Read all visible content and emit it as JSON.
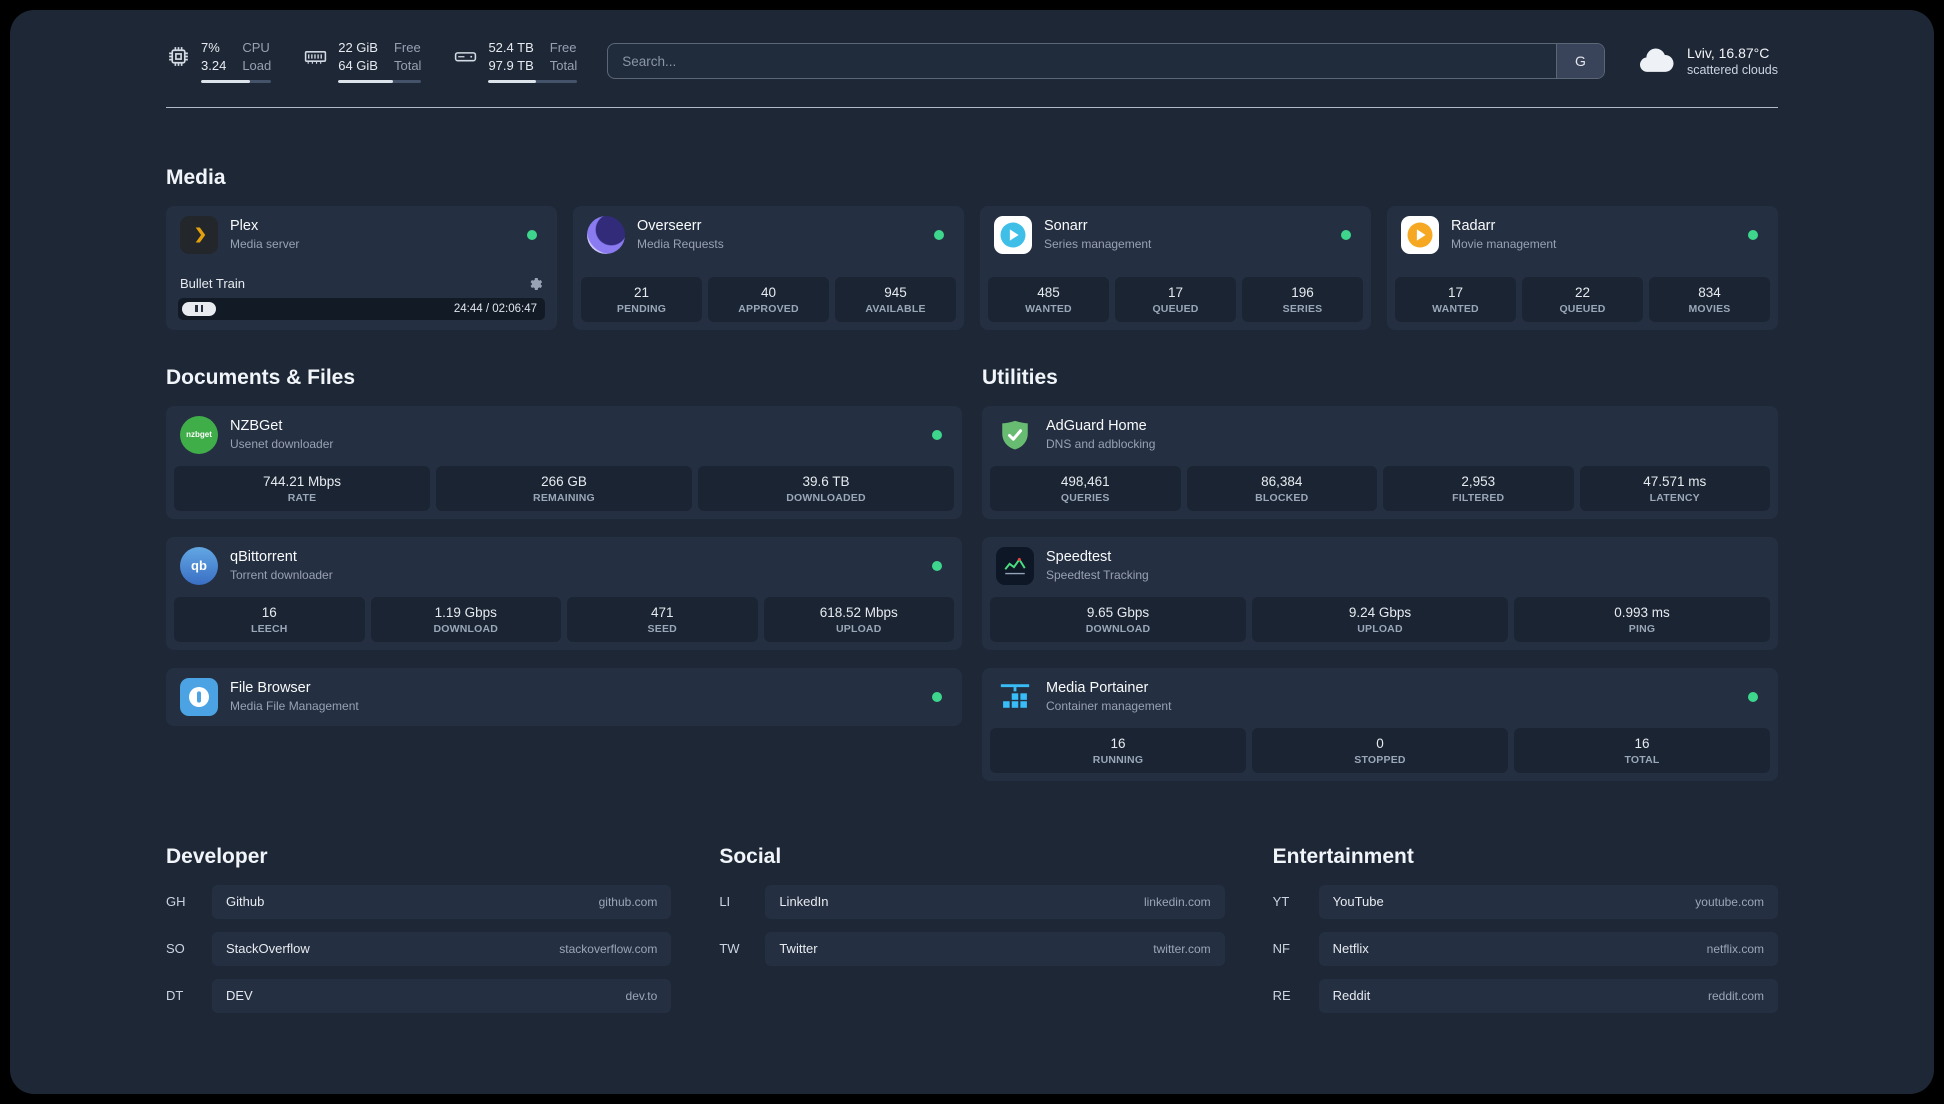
{
  "colors": {
    "status_online": "#3dd68c",
    "plex": "#e5a00d",
    "overseerr": "#8a7bf0",
    "sonarr": "#3fbfe8",
    "radarr": "#f7a823",
    "nzbget": "#3fae49",
    "qbittorrent": "#4e8fd5",
    "filebrowser": "#4ba3e3",
    "adguard": "#68bc71",
    "speedtest_line": "#4ade80",
    "portainer": "#38bdf8"
  },
  "topbar": {
    "resources": [
      {
        "name": "cpu",
        "value_top": "7%",
        "label_top": "CPU",
        "value_bottom": "3.24",
        "label_bottom": "Load",
        "bar_style": "width:70%"
      },
      {
        "name": "memory",
        "value_top": "22 GiB",
        "label_top": "Free",
        "value_bottom": "64 GiB",
        "label_bottom": "Total",
        "bar_style": "width:66%"
      },
      {
        "name": "disk",
        "value_top": "52.4 TB",
        "label_top": "Free",
        "value_bottom": "97.9 TB",
        "label_bottom": "Total",
        "bar_style": "width:54%"
      }
    ],
    "search": {
      "placeholder": "Search...",
      "provider": "G"
    },
    "weather": {
      "location": "Lviv, 16.87°C",
      "condition": "scattered clouds"
    }
  },
  "media": {
    "title": "Media",
    "cards": [
      {
        "title": "Plex",
        "subtitle": "Media server",
        "player": {
          "track": "Bullet Train",
          "time": "24:44 / 02:06:47"
        }
      },
      {
        "title": "Overseerr",
        "subtitle": "Media Requests",
        "stats": [
          {
            "value": "21",
            "label": "PENDING"
          },
          {
            "value": "40",
            "label": "APPROVED"
          },
          {
            "value": "945",
            "label": "AVAILABLE"
          }
        ]
      },
      {
        "title": "Sonarr",
        "subtitle": "Series management",
        "stats": [
          {
            "value": "485",
            "label": "WANTED"
          },
          {
            "value": "17",
            "label": "QUEUED"
          },
          {
            "value": "196",
            "label": "SERIES"
          }
        ]
      },
      {
        "title": "Radarr",
        "subtitle": "Movie management",
        "stats": [
          {
            "value": "17",
            "label": "WANTED"
          },
          {
            "value": "22",
            "label": "QUEUED"
          },
          {
            "value": "834",
            "label": "MOVIES"
          }
        ]
      }
    ]
  },
  "documents": {
    "title": "Documents & Files",
    "cards": [
      {
        "title": "NZBGet",
        "subtitle": "Usenet downloader",
        "icon_text": "nzbget",
        "stats": [
          {
            "value": "744.21 Mbps",
            "label": "RATE"
          },
          {
            "value": "266 GB",
            "label": "REMAINING"
          },
          {
            "value": "39.6 TB",
            "label": "DOWNLOADED"
          }
        ]
      },
      {
        "title": "qBittorrent",
        "subtitle": "Torrent downloader",
        "icon_text": "qb",
        "stats": [
          {
            "value": "16",
            "label": "LEECH"
          },
          {
            "value": "1.19 Gbps",
            "label": "DOWNLOAD"
          },
          {
            "value": "471",
            "label": "SEED"
          },
          {
            "value": "618.52 Mbps",
            "label": "UPLOAD"
          }
        ]
      },
      {
        "title": "File Browser",
        "subtitle": "Media File Management"
      }
    ]
  },
  "utilities": {
    "title": "Utilities",
    "cards": [
      {
        "title": "AdGuard Home",
        "subtitle": "DNS and adblocking",
        "stats": [
          {
            "value": "498,461",
            "label": "QUERIES"
          },
          {
            "value": "86,384",
            "label": "BLOCKED"
          },
          {
            "value": "2,953",
            "label": "FILTERED"
          },
          {
            "value": "47.571 ms",
            "label": "LATENCY"
          }
        ]
      },
      {
        "title": "Speedtest",
        "subtitle": "Speedtest Tracking",
        "stats": [
          {
            "value": "9.65 Gbps",
            "label": "DOWNLOAD"
          },
          {
            "value": "9.24 Gbps",
            "label": "UPLOAD"
          },
          {
            "value": "0.993 ms",
            "label": "PING"
          }
        ]
      },
      {
        "title": "Media Portainer",
        "subtitle": "Container management",
        "stats": [
          {
            "value": "16",
            "label": "RUNNING"
          },
          {
            "value": "0",
            "label": "STOPPED"
          },
          {
            "value": "16",
            "label": "TOTAL"
          }
        ]
      }
    ]
  },
  "bookmarks": [
    {
      "title": "Developer",
      "items": [
        {
          "abbr": "GH",
          "name": "Github",
          "domain": "github.com"
        },
        {
          "abbr": "SO",
          "name": "StackOverflow",
          "domain": "stackoverflow.com"
        },
        {
          "abbr": "DT",
          "name": "DEV",
          "domain": "dev.to"
        }
      ]
    },
    {
      "title": "Social",
      "items": [
        {
          "abbr": "LI",
          "name": "LinkedIn",
          "domain": "linkedin.com"
        },
        {
          "abbr": "TW",
          "name": "Twitter",
          "domain": "twitter.com"
        }
      ]
    },
    {
      "title": "Entertainment",
      "items": [
        {
          "abbr": "YT",
          "name": "YouTube",
          "domain": "youtube.com"
        },
        {
          "abbr": "NF",
          "name": "Netflix",
          "domain": "netflix.com"
        },
        {
          "abbr": "RE",
          "name": "Reddit",
          "domain": "reddit.com"
        }
      ]
    }
  ]
}
